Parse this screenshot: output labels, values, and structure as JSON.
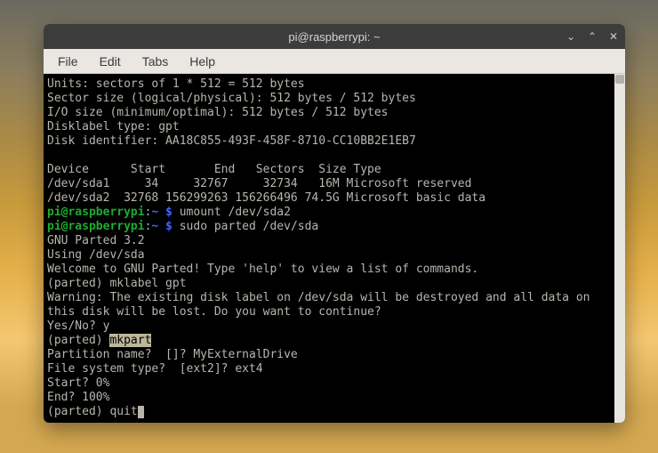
{
  "titlebar": {
    "title": "pi@raspberrypi: ~"
  },
  "menubar": {
    "file": "File",
    "edit": "Edit",
    "tabs": "Tabs",
    "help": "Help"
  },
  "output": {
    "l01": "Units: sectors of 1 * 512 = 512 bytes",
    "l02": "Sector size (logical/physical): 512 bytes / 512 bytes",
    "l03": "I/O size (minimum/optimal): 512 bytes / 512 bytes",
    "l04": "Disklabel type: gpt",
    "l05": "Disk identifier: AA18C855-493F-458F-8710-CC10BB2E1EB7",
    "l06": "",
    "l07": "Device      Start       End   Sectors  Size Type",
    "l08": "/dev/sda1     34     32767     32734   16M Microsoft reserved",
    "l09": "/dev/sda2  32768 156299263 156266496 74.5G Microsoft basic data",
    "prompt_user": "pi@raspberrypi",
    "prompt_sep": ":",
    "prompt_path": "~",
    "prompt_dollar": " $ ",
    "cmd1": "umount /dev/sda2",
    "cmd2": "sudo parted /dev/sda",
    "l12": "GNU Parted 3.2",
    "l13": "Using /dev/sda",
    "l14": "Welcome to GNU Parted! Type 'help' to view a list of commands.",
    "l15": "(parted) mklabel gpt",
    "l16": "Warning: The existing disk label on /dev/sda will be destroyed and all data on",
    "l17": "this disk will be lost. Do you want to continue?",
    "l18": "Yes/No? y",
    "l19a": "(parted) ",
    "l19b": "mkpart",
    "l20": "Partition name?  []? MyExternalDrive",
    "l21": "File system type?  [ext2]? ext4",
    "l22": "Start? 0%",
    "l23": "End? 100%",
    "l24": "(parted) quit"
  }
}
